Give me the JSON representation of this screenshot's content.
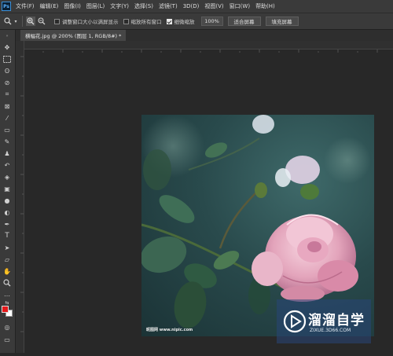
{
  "app": {
    "logo_text": "Ps"
  },
  "menu": [
    "文件(F)",
    "编辑(E)",
    "图像(I)",
    "图层(L)",
    "文字(Y)",
    "选择(S)",
    "滤镜(T)",
    "3D(D)",
    "视图(V)",
    "窗口(W)",
    "帮助(H)"
  ],
  "options": {
    "resize_windows_label": "调整窗口大小以满屏显示",
    "zoom_all_label": "缩放所有窗口",
    "scrubby_zoom_label": "细微缩放",
    "zoom_value": "100%",
    "fit_screen_label": "适合屏幕",
    "fill_screen_label": "填充屏幕",
    "scrubby_zoom_checked": true
  },
  "document_tab": {
    "title": "横幅花.jpg @ 200% (图层 1, RGB/8#) *"
  },
  "colors": {
    "foreground": "#e4191b",
    "background": "#ffffff"
  },
  "image": {
    "caption": "昵图网 www.nipic.com"
  },
  "watermark": {
    "title": "溜溜自学",
    "subtitle": "ZIXUE.3D66.COM"
  }
}
